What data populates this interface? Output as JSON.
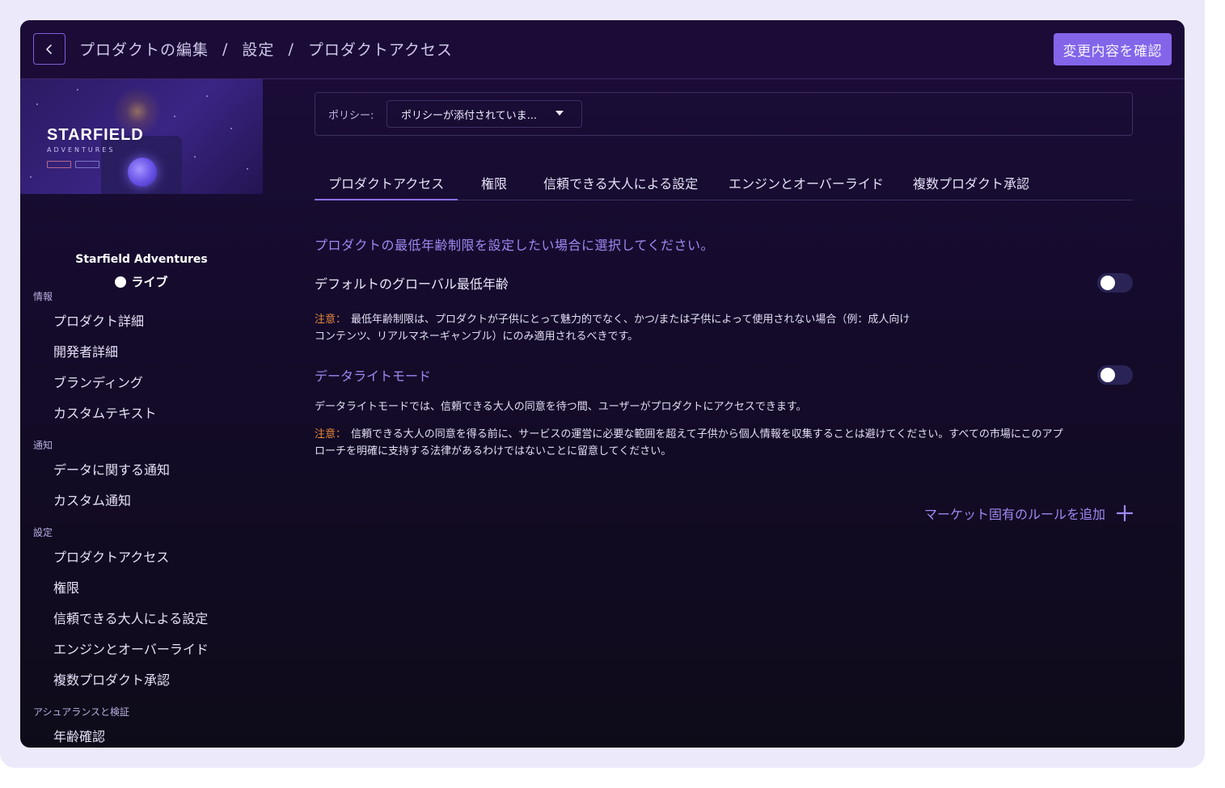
{
  "header": {
    "breadcrumb": [
      "プロダクトの編集",
      "設定",
      "プロダクトアクセス"
    ],
    "separator": "/",
    "confirm_label": "変更内容を確認"
  },
  "banner": {
    "title": "STARFIELD",
    "subtitle": "ADVENTURES"
  },
  "product": {
    "name": "Starfield Adventures",
    "status": "ライブ"
  },
  "sidebar": {
    "sections": [
      {
        "label": "情報",
        "items": [
          "プロダクト詳細",
          "開発者詳細",
          "ブランディング",
          "カスタムテキスト"
        ]
      },
      {
        "label": "通知",
        "items": [
          "データに関する通知",
          "カスタム通知"
        ]
      },
      {
        "label": "設定",
        "items": [
          "プロダクトアクセス",
          "権限",
          "信頼できる大人による設定",
          "エンジンとオーバーライド",
          "複数プロダクト承認"
        ]
      },
      {
        "label": "アシュアランスと検証",
        "items": [
          "年齢確認"
        ]
      }
    ]
  },
  "policy": {
    "label": "ポリシー:",
    "selected": "ポリシーが添付されていま..."
  },
  "tabs": [
    "プロダクトアクセス",
    "権限",
    "信頼できる大人による設定",
    "エンジンとオーバーライド",
    "複数プロダクト承認"
  ],
  "content": {
    "intro": "プロダクトの最低年齢制限を設定したい場合に選択してください。",
    "default_age_label": "デフォルトのグローバル最低年齢",
    "default_age_on": false,
    "note_prefix": "注意：",
    "note1_line1": "最低年齢制限は、プロダクトが子供にとって魅力的でなく、かつ/または子供によって使用されない場合（例：成人向け",
    "note1_line2": "コンテンツ、リアルマネーギャンブル）にのみ適用されるべきです。",
    "data_light_label": "データライトモード",
    "data_light_on": false,
    "data_light_desc": "データライトモードでは、信頼できる大人の同意を待つ間、ユーザーがプロダクトにアクセスできます。",
    "note2_line1": "信頼できる大人の同意を得る前に、サービスの運営に必要な範囲を超えて子供から個人情報を収集することは避けてください。すべての市場にこのアプ",
    "note2_line2": "ローチを明確に支持する法律があるわけではないことに留意してください。",
    "add_rule_label": "マーケット固有のルールを追加"
  }
}
